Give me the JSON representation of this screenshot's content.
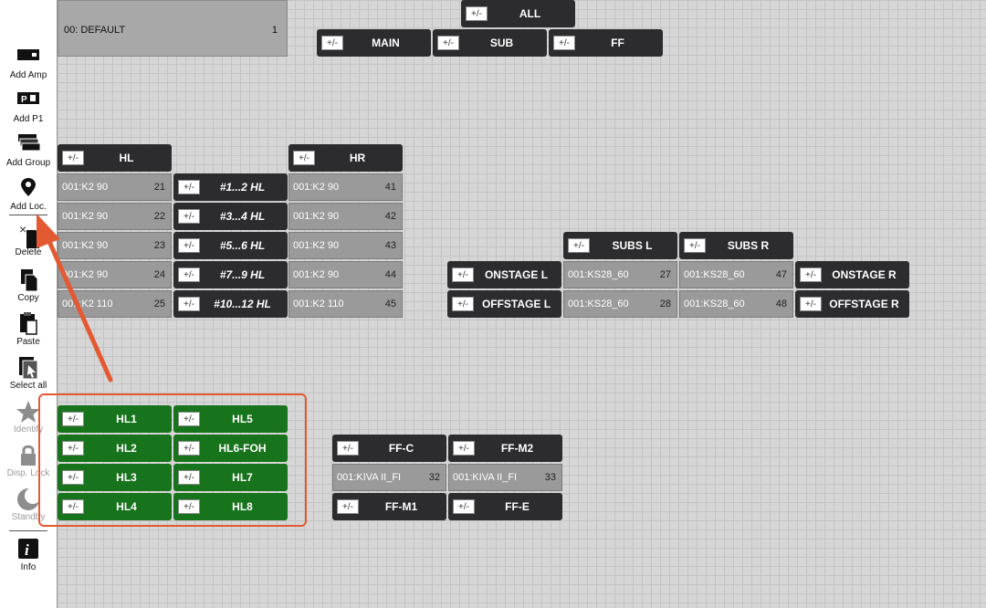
{
  "toolbar": {
    "add_amp": "Add Amp",
    "add_p1": "Add P1",
    "add_group": "Add Group",
    "add_loc": "Add Loc.",
    "delete": "Delete",
    "copy": "Copy",
    "paste": "Paste",
    "select_all": "Select all",
    "identify": "Identify",
    "disp_lock": "Disp. Lock",
    "standby": "Standby",
    "info": "Info"
  },
  "preset": {
    "name": "00: DEFAULT",
    "number": "1"
  },
  "pm": "+/-",
  "groups": {
    "all": "ALL",
    "main": "MAIN",
    "sub": "SUB",
    "ff": "FF",
    "hl": "HL",
    "hr": "HR",
    "hl_1_2": "#1...2 HL",
    "hl_3_4": "#3...4 HL",
    "hl_5_6": "#5...6 HL",
    "hl_7_9": "#7...9 HL",
    "hl_10_12": "#10...12 HL",
    "subs_l": "SUBS L",
    "subs_r": "SUBS R",
    "onstage_l": "ONSTAGE L",
    "offstage_l": "OFFSTAGE L",
    "onstage_r": "ONSTAGE R",
    "offstage_r": "OFFSTAGE R",
    "hl1": "HL1",
    "hl2": "HL2",
    "hl3": "HL3",
    "hl4": "HL4",
    "hl5": "HL5",
    "hl6": "HL6-FOH",
    "hl7": "HL7",
    "hl8": "HL8",
    "ff_c": "FF-C",
    "ff_m2": "FF-M2",
    "ff_m1": "FF-M1",
    "ff_e": "FF-E"
  },
  "speakers": {
    "hl": [
      {
        "name": "001:K2 90",
        "id": "21"
      },
      {
        "name": "001:K2 90",
        "id": "22"
      },
      {
        "name": "001:K2 90",
        "id": "23"
      },
      {
        "name": "001:K2 90",
        "id": "24"
      },
      {
        "name": "001:K2 110",
        "id": "25"
      }
    ],
    "hr": [
      {
        "name": "001:K2 90",
        "id": "41"
      },
      {
        "name": "001:K2 90",
        "id": "42"
      },
      {
        "name": "001:K2 90",
        "id": "43"
      },
      {
        "name": "001:K2 90",
        "id": "44"
      },
      {
        "name": "001:K2 110",
        "id": "45"
      }
    ],
    "subs_l": [
      {
        "name": "001:KS28_60",
        "id": "27"
      },
      {
        "name": "001:KS28_60",
        "id": "28"
      }
    ],
    "subs_r": [
      {
        "name": "001:KS28_60",
        "id": "47"
      },
      {
        "name": "001:KS28_60",
        "id": "48"
      }
    ],
    "ff_c": {
      "name": "001:KIVA II_FI",
      "id": "32"
    },
    "ff_m2": {
      "name": "001:KIVA II_FI",
      "id": "33"
    }
  },
  "colors": {
    "group_dark": "#2c2c2e",
    "group_green": "#17731c",
    "speaker_gray": "#9a9a9a",
    "annotation": "#e35a32"
  }
}
